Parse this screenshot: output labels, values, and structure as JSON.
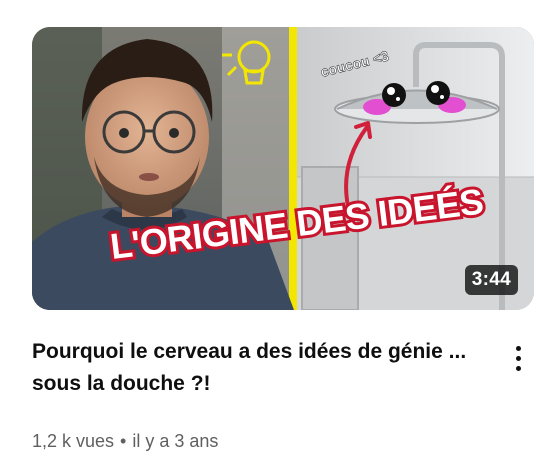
{
  "video": {
    "title": "Pourquoi le cerveau a des idées de génie ... sous la douche ?!",
    "duration": "3:44",
    "views": "1,2 k vues",
    "separator": "•",
    "age": "il y a 3 ans"
  },
  "thumbnail": {
    "headline": "L'ORIGINE DES IDEÉS",
    "sticker_text": "coucou <3",
    "icons": [
      "lightbulb-icon",
      "arrow-icon",
      "shower-head-icon"
    ]
  },
  "menu": {
    "icon": "more-vert-icon"
  },
  "colors": {
    "headline_fill": "#ffffff",
    "headline_stroke": "#c8142c",
    "accent_yellow": "#f3e600",
    "title_text": "#0f0f0f",
    "meta_text": "#606060"
  }
}
